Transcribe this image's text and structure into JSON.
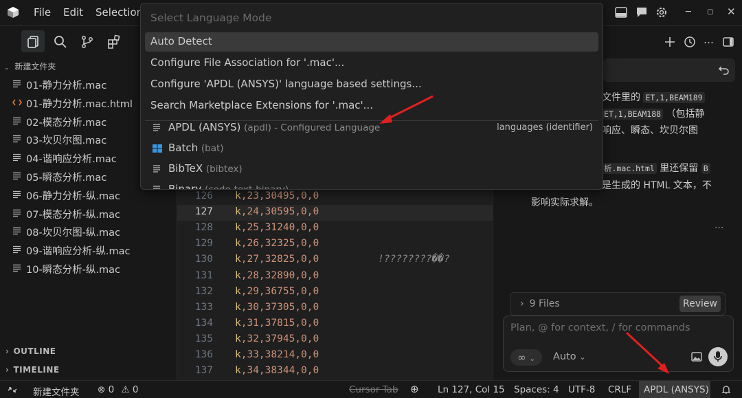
{
  "menu": {
    "file": "File",
    "edit": "Edit",
    "selection": "Selection"
  },
  "quickpick": {
    "placeholder": "Select Language Mode",
    "items": [
      {
        "label": "Auto Detect"
      },
      {
        "label": "Configure File Association for '.mac'..."
      },
      {
        "label": "Configure 'APDL (ANSYS)' language based settings..."
      },
      {
        "label": "Search Marketplace Extensions for '.mac'..."
      }
    ],
    "languages": [
      {
        "label": "APDL (ANSYS)",
        "desc": "(apdl) - Configured Language",
        "right": "languages (identifier)",
        "icon": "lines-icon"
      },
      {
        "label": "Batch",
        "desc": "(bat)",
        "icon": "windows-icon"
      },
      {
        "label": "BibTeX",
        "desc": "(bibtex)",
        "icon": "lines-icon"
      },
      {
        "label": "Binary",
        "desc": "(code-text-binary)",
        "icon": "lines-icon"
      }
    ]
  },
  "explorer": {
    "folder": "新建文件夹",
    "files": [
      {
        "name": "01-静力分析.mac",
        "icon": "lines-icon"
      },
      {
        "name": "01-静力分析.mac.html",
        "icon": "html-icon"
      },
      {
        "name": "02-模态分析.mac",
        "icon": "lines-icon"
      },
      {
        "name": "03-坎贝尔图.mac",
        "icon": "lines-icon"
      },
      {
        "name": "04-谐响应分析.mac",
        "icon": "lines-icon"
      },
      {
        "name": "05-瞬态分析.mac",
        "icon": "lines-icon"
      },
      {
        "name": "06-静力分析-纵.mac",
        "icon": "lines-icon"
      },
      {
        "name": "07-模态分析-纵.mac",
        "icon": "lines-icon"
      },
      {
        "name": "08-坎贝尔图-纵.mac",
        "icon": "lines-icon"
      },
      {
        "name": "09-谐响应分析-纵.mac",
        "icon": "lines-icon"
      },
      {
        "name": "10-瞬态分析-纵.mac",
        "icon": "lines-icon"
      }
    ],
    "outline": "OUTLINE",
    "timeline": "TIMELINE"
  },
  "editor": {
    "current_line": 127,
    "lines": [
      {
        "num": "126",
        "k": "k",
        "rest": ",23,30495,0,0"
      },
      {
        "num": "127",
        "k": "k",
        "rest": ",24,30595,0,0"
      },
      {
        "num": "128",
        "k": "k",
        "rest": ",25,31240,0,0"
      },
      {
        "num": "129",
        "k": "k",
        "rest": ",26,32325,0,0"
      },
      {
        "num": "130",
        "k": "k",
        "rest": ",27,32825,0,0"
      },
      {
        "num": "131",
        "k": "k",
        "rest": ",28,32890,0,0"
      },
      {
        "num": "132",
        "k": "k",
        "rest": ",29,36755,0,0"
      },
      {
        "num": "133",
        "k": "k",
        "rest": ",30,37305,0,0"
      },
      {
        "num": "134",
        "k": "k",
        "rest": ",31,37815,0,0"
      },
      {
        "num": "135",
        "k": "k",
        "rest": ",32,37945,0,0"
      },
      {
        "num": "136",
        "k": "k",
        "rest": ",33,38214,0,0"
      },
      {
        "num": "137",
        "k": "k",
        "rest": ",34,38344,0,0"
      }
    ],
    "garbled_comment": "!????????��?"
  },
  "chat": {
    "line1_pre": "文件里的 ",
    "line1_code": "ET,1,BEAM189",
    "line2_code": "ET,1,BEAM188",
    "line2_post": " （包括静",
    "line3": "响应、瞬态、坎贝尔图",
    "line4_code": "析.mac.html",
    "line4_post": " 里还保留 ",
    "line4_tail": "B",
    "line5": "是生成的 HTML 文本，不",
    "line6": "影响实际求解。",
    "more": "...",
    "files_label": "9 Files",
    "review": "Review",
    "composer_placeholder": "Plan, @ for context, / for commands",
    "mode_symbol": "∞",
    "model": "Auto"
  },
  "statusbar": {
    "folder": "新建文件夹",
    "errors": "0",
    "warnings": "0",
    "cursor_tab": "Cursor Tab",
    "position": "Ln 127, Col 15",
    "spaces": "Spaces: 4",
    "encoding": "UTF-8",
    "eol": "CRLF",
    "language": "APDL (ANSYS)"
  },
  "colors": {
    "arrow": "#e02020",
    "accent": "#0078d4"
  }
}
